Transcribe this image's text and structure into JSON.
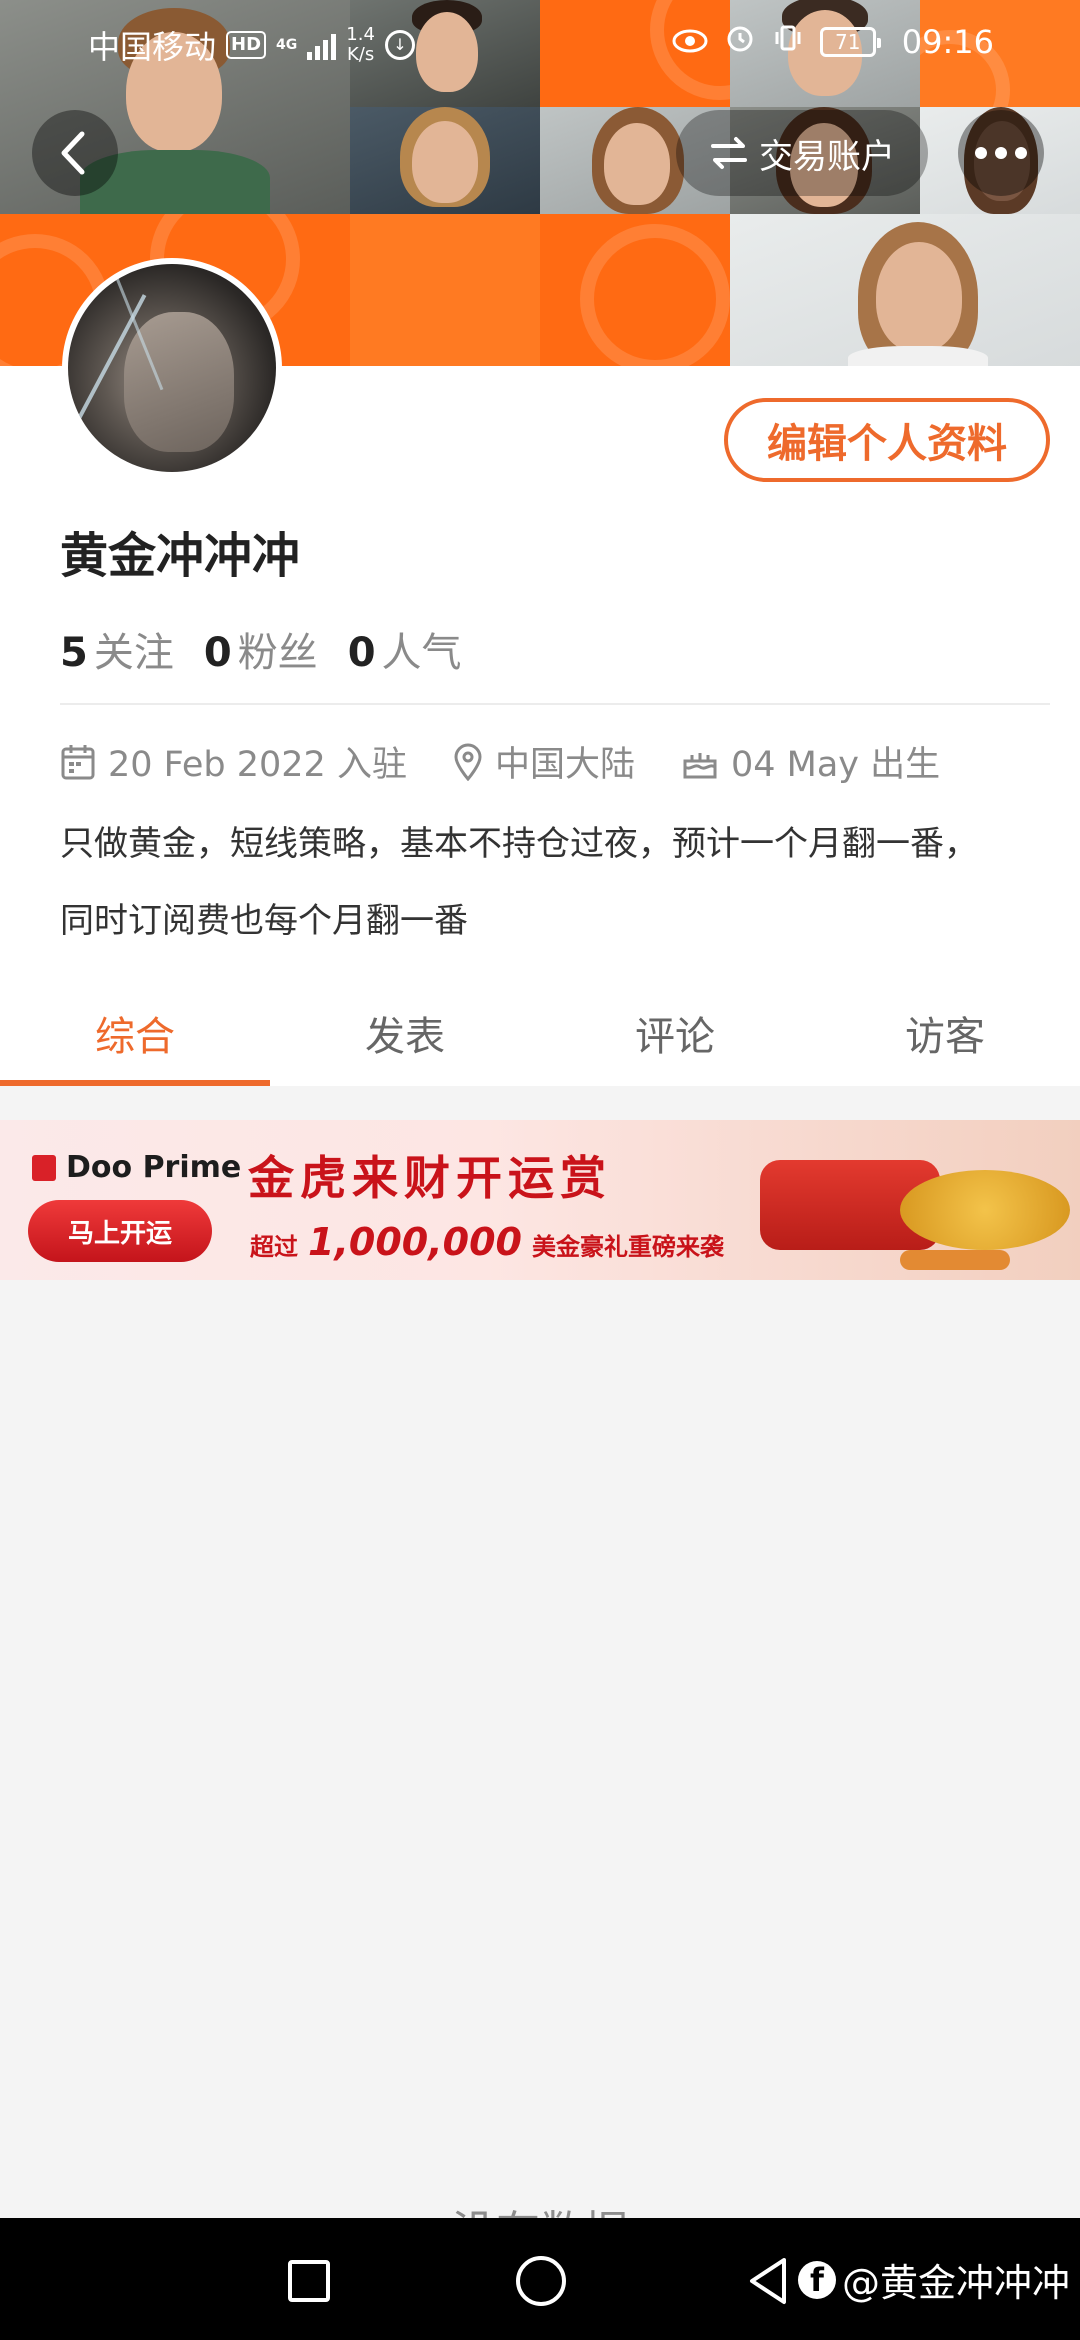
{
  "status_bar": {
    "carrier": "中国移动",
    "hd": "HD",
    "network": "4G",
    "speed_value": "1.4",
    "speed_unit": "K/s",
    "battery": "71",
    "time": "09:16"
  },
  "header": {
    "trade_account": "交易账户"
  },
  "profile": {
    "edit_button": "编辑个人资料",
    "username": "黄金冲冲冲",
    "stats": [
      {
        "value": "5",
        "label": "关注"
      },
      {
        "value": "0",
        "label": "粉丝"
      },
      {
        "value": "0",
        "label": "人气"
      }
    ],
    "join_date": "20 Feb 2022 入驻",
    "location": "中国大陆",
    "birthday": "04 May 出生",
    "bio_line1": "只做黄金，短线策略，基本不持仓过夜，预计一个月翻一番，",
    "bio_line2": "同时订阅费也每个月翻一番"
  },
  "tabs": [
    {
      "label": "综合",
      "active": true
    },
    {
      "label": "发表",
      "active": false
    },
    {
      "label": "评论",
      "active": false
    },
    {
      "label": "访客",
      "active": false
    }
  ],
  "ad": {
    "brand": "Doo Prime",
    "cta": "马上开运",
    "title": "金虎来财开运赏",
    "sub_prefix": "超过",
    "sub_amount": "1,000,000",
    "sub_suffix": "美金豪礼重磅来袭"
  },
  "empty_text": "没有数据",
  "watermark": {
    "logo": "f",
    "text": "@黄金冲冲冲"
  },
  "colors": {
    "accent": "#ee6a2c",
    "banner_orange": "#ff6a13",
    "ad_red": "#c9131a"
  }
}
